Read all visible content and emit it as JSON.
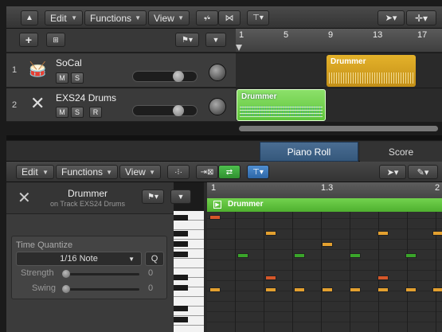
{
  "top_toolbar": {
    "edit": "Edit",
    "functions": "Functions",
    "view": "View"
  },
  "ruler_top": {
    "marks": [
      "1",
      "5",
      "9",
      "13",
      "17"
    ]
  },
  "tracks": [
    {
      "number": "1",
      "name": "SoCal",
      "buttons": [
        "M",
        "S"
      ],
      "icon": "drum-kit-icon"
    },
    {
      "number": "2",
      "name": "EXS24 Drums",
      "buttons": [
        "M",
        "S",
        "R"
      ],
      "icon": "drumsticks-icon"
    }
  ],
  "regions": {
    "socal": "Drummer",
    "exs": "Drummer"
  },
  "tabs": {
    "piano_roll": "Piano Roll",
    "score": "Score"
  },
  "editor_toolbar": {
    "edit": "Edit",
    "functions": "Functions",
    "view": "View"
  },
  "inspector": {
    "region_name": "Drummer",
    "on_track": "on Track EXS24 Drums",
    "time_quantize_label": "Time Quantize",
    "quantize_value": "1/16 Note",
    "q_button": "Q",
    "strength_label": "Strength",
    "strength_value": "0",
    "swing_label": "Swing",
    "swing_value": "0"
  },
  "ruler_editor": {
    "marks": [
      "1",
      "1.3",
      "2"
    ]
  },
  "editor_region": "Drummer",
  "colors": {
    "yellow_region": "#d7a31e",
    "green_region": "#6fd14a",
    "tab_active": "#3a5b7d",
    "note_green": "#3aa52a",
    "note_orange": "#e09a2c",
    "note_red": "#d0562a"
  }
}
